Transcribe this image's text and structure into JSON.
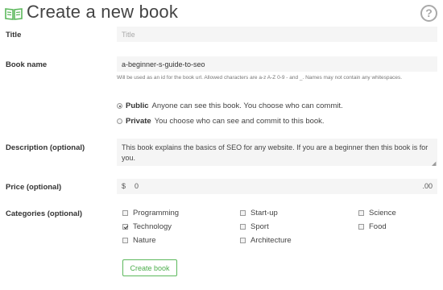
{
  "header": {
    "book_icon": "open-book-icon",
    "title": "Create a new book",
    "help_icon": "question-mark-icon",
    "help_glyph": "?"
  },
  "colors": {
    "accent": "#5cb85c",
    "icon_green": "#5cb85c",
    "input_bg": "#f5f5f5",
    "help_gray": "#a9a9a9"
  },
  "form": {
    "title": {
      "label": "Title",
      "placeholder": "Title",
      "value": ""
    },
    "book_name": {
      "label": "Book name",
      "value": "a-beginner-s-guide-to-seo",
      "hint": "Will be used as an id for the book url. Allowed characters are a-z A-Z 0-9 - and _. Names may not contain any whitespaces."
    },
    "visibility": {
      "options": [
        {
          "name": "Public",
          "description": "Anyone can see this book. You choose who can commit.",
          "selected": true
        },
        {
          "name": "Private",
          "description": "You choose who can see and commit to this book.",
          "selected": false
        }
      ]
    },
    "description": {
      "label": "Description (optional)",
      "value": "This book explains the basics of SEO for any website. If you are a beginner then this book is for you."
    },
    "price": {
      "label": "Price (optional)",
      "currency": "$",
      "value": "0",
      "cents": ".00"
    },
    "categories": {
      "label": "Categories (optional)",
      "items": [
        {
          "label": "Programming",
          "checked": false
        },
        {
          "label": "Start-up",
          "checked": false
        },
        {
          "label": "Science",
          "checked": false
        },
        {
          "label": "Technology",
          "checked": true
        },
        {
          "label": "Sport",
          "checked": false
        },
        {
          "label": "Food",
          "checked": false
        },
        {
          "label": "Nature",
          "checked": false
        },
        {
          "label": "Architecture",
          "checked": false
        }
      ]
    },
    "submit_label": "Create book"
  }
}
